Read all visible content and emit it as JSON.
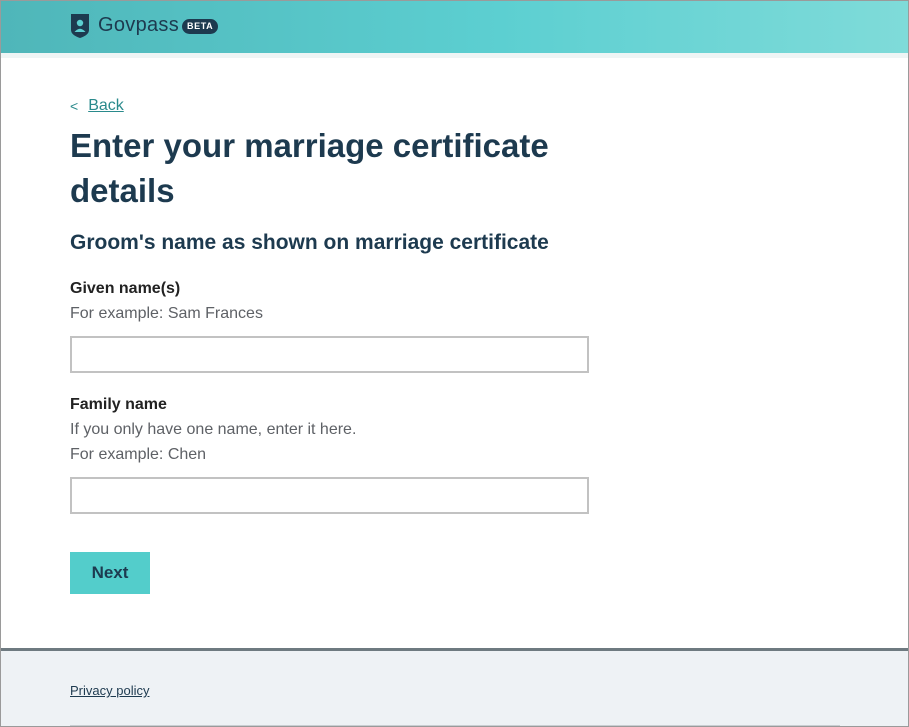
{
  "header": {
    "brand": "Govpass",
    "badge": "BETA",
    "logo_icon": "shield-person-icon"
  },
  "nav": {
    "back_chevron": "<",
    "back_label": "Back"
  },
  "main": {
    "title": "Enter your marriage certificate details",
    "section_heading": "Groom's name as shown on marriage certificate",
    "given": {
      "label": "Given name(s)",
      "hint": "For example: Sam Frances",
      "value": ""
    },
    "family": {
      "label": "Family name",
      "hint_1": "If you only have one name, enter it here.",
      "hint_2": "For example: Chen",
      "value": ""
    },
    "next_label": "Next"
  },
  "footer": {
    "privacy_label": "Privacy policy"
  },
  "colors": {
    "header_start": "#4fb6b9",
    "header_end": "#7fdbd9",
    "brand_navy": "#1d3a4f",
    "button_teal": "#53cdcb",
    "link_teal": "#2a8a8c"
  }
}
